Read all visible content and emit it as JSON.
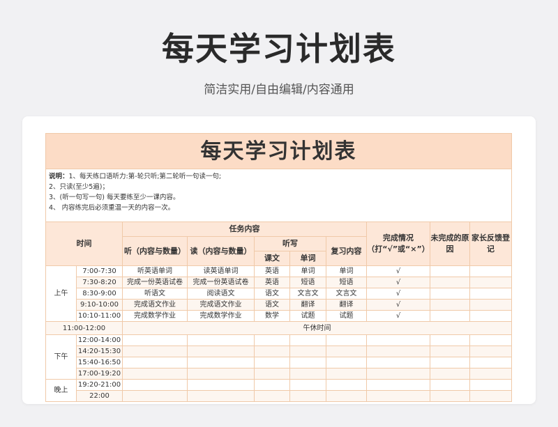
{
  "header": {
    "title": "每天学习计划表",
    "subtitle": "简洁实用/自由编辑/内容通用"
  },
  "sheet": {
    "title": "每天学习计划表",
    "notes_label": "说明：",
    "notes": [
      "1、每天练口语听力:第-轮只听;第二轮听一句读一句;",
      "2、只读(至少5遍)；",
      "3、(听一句写一句) 每天要练至少一课内容。",
      "4、 内容练完后必须重温一天的内容一次。"
    ],
    "headers": {
      "time": "时间",
      "tasks": "任务内容",
      "listen": "听（内容与数量）",
      "read": "读（内容与数量）",
      "dictation": "听写",
      "text": "课文",
      "words": "单词",
      "review": "复习内容",
      "completion": "完成情况（打“√”或“×”）",
      "reason": "未完成的原因",
      "parent": "家长反馈登记"
    },
    "morning": {
      "label": "上午",
      "rows": [
        {
          "time": "7:00-7:30",
          "listen": "听英语单词",
          "read": "读英语单词",
          "text": "英语",
          "words": "单词",
          "review": "单词",
          "done": "√"
        },
        {
          "time": "7:30-8:20",
          "listen": "完成一份英语试卷",
          "read": "完成一份英语试卷",
          "text": "英语",
          "words": "短语",
          "review": "短语",
          "done": "√"
        },
        {
          "time": "8:30-9:00",
          "listen": "听语文",
          "read": "阅读语文",
          "text": "语文",
          "words": "文言文",
          "review": "文言文",
          "done": "√"
        },
        {
          "time": "9:10-10:00",
          "listen": "完成语文作业",
          "read": "完成语文作业",
          "text": "语文",
          "words": "翻译",
          "review": "翻译",
          "done": "√"
        },
        {
          "time": "10:10-11:00",
          "listen": "完成数学作业",
          "read": "完成数学作业",
          "text": "数学",
          "words": "试题",
          "review": "试题",
          "done": "√"
        }
      ]
    },
    "noon": {
      "time": "11:00-12:00",
      "label": "午休时间"
    },
    "afternoon": {
      "label": "下午",
      "times": [
        "12:00-14:00",
        "14:20-15:30",
        "15:40-16:50",
        "17:00-19:20"
      ]
    },
    "evening": {
      "label": "晚上",
      "times": [
        "19:20-21:00",
        "22:00"
      ]
    }
  }
}
